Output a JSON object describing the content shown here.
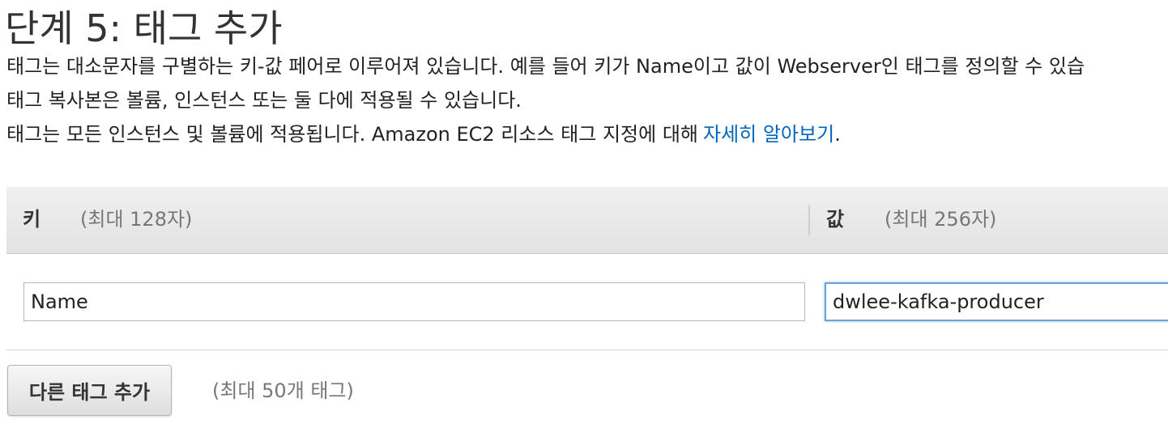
{
  "step": {
    "title": "단계 5: 태그 추가",
    "description": {
      "line1": "태그는 대소문자를 구별하는 키-값 페어로 이루어져 있습니다. 예를 들어 키가 Name이고 값이 Webserver인 태그를 정의할 수 있습",
      "line2": "태그 복사본은 볼륨, 인스턴스 또는 둘 다에 적용될 수 있습니다.",
      "line3": "태그는 모든 인스턴스 및 볼륨에 적용됩니다. Amazon EC2 리소스 태그 지정에 대해",
      "learn_more_link": "자세히 알아보기",
      "line3_suffix": "."
    }
  },
  "tag_table": {
    "key_column": {
      "label": "키",
      "hint": "(최대 128자)"
    },
    "value_column": {
      "label": "값",
      "hint": "(최대 256자)"
    },
    "rows": [
      {
        "key": "Name",
        "value": "dwlee-kafka-producer"
      }
    ]
  },
  "actions": {
    "add_tag_label": "다른 태그 추가",
    "max_tags_hint": "(최대 50개 태그)"
  }
}
